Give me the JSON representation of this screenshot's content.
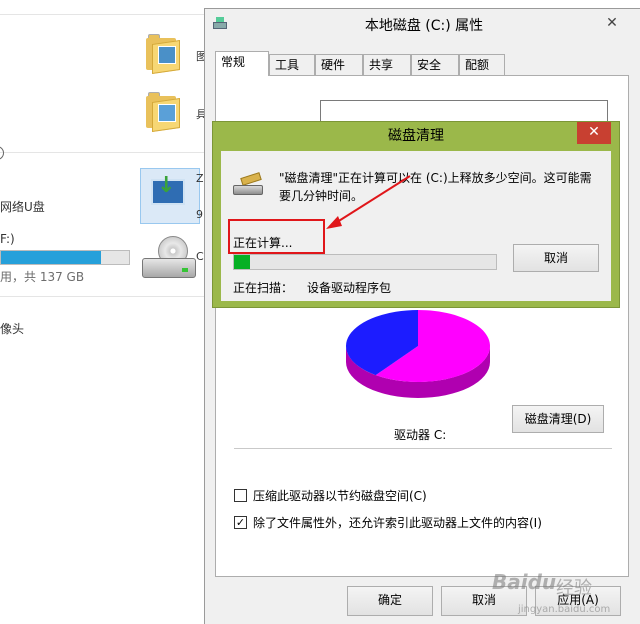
{
  "explorer": {
    "folder1_letter": "图",
    "folder2_letter": "具",
    "net_drive": "网络U盘",
    "drive_label": "F:)",
    "drive_usage_text": "用，共 137 GB",
    "drive_usage_fraction": 0.78,
    "tile_letter1": "Z",
    "tile_letter2": "9",
    "hdd_letter": "C",
    "camera": "像头"
  },
  "properties": {
    "title": "本地磁盘 (C:) 属性",
    "close_icon": "✕",
    "tabs": [
      "常规",
      "工具",
      "硬件",
      "共享",
      "安全",
      "配额"
    ],
    "active_tab": 0,
    "drive_name_value": "",
    "drive_caption": "驱动器 C:",
    "disk_cleanup_button": "磁盘清理(D)",
    "compress_option": "压缩此驱动器以节约磁盘空间(C)",
    "compress_checked": false,
    "index_option": "除了文件属性外，还允许索引此驱动器上文件的内容(I)",
    "index_checked": true,
    "ok_button": "确定",
    "cancel_button": "取消",
    "apply_button": "应用(A)",
    "pie": {
      "used_color": "#ff00ff",
      "free_color": "#1c1cff",
      "used_fraction": 0.6
    }
  },
  "cleanup": {
    "title": "磁盘清理",
    "close_icon": "✕",
    "message": "\"磁盘清理\"正在计算可以在 (C:)上释放多少空间。这可能需要几分钟时间。",
    "status": "正在计算...",
    "progress_fraction": 0.06,
    "cancel_button": "取消",
    "scan_label": "正在扫描：",
    "scan_value": "设备驱动程序包"
  },
  "watermark": {
    "brand": "Baidu",
    "suffix": "经验",
    "url": "jingyan.baidu.com"
  },
  "colors": {
    "cleanup_frame": "#9bb84a",
    "close_red": "#c84031",
    "progress_green": "#06b025",
    "annotation_red": "#e0161a"
  }
}
